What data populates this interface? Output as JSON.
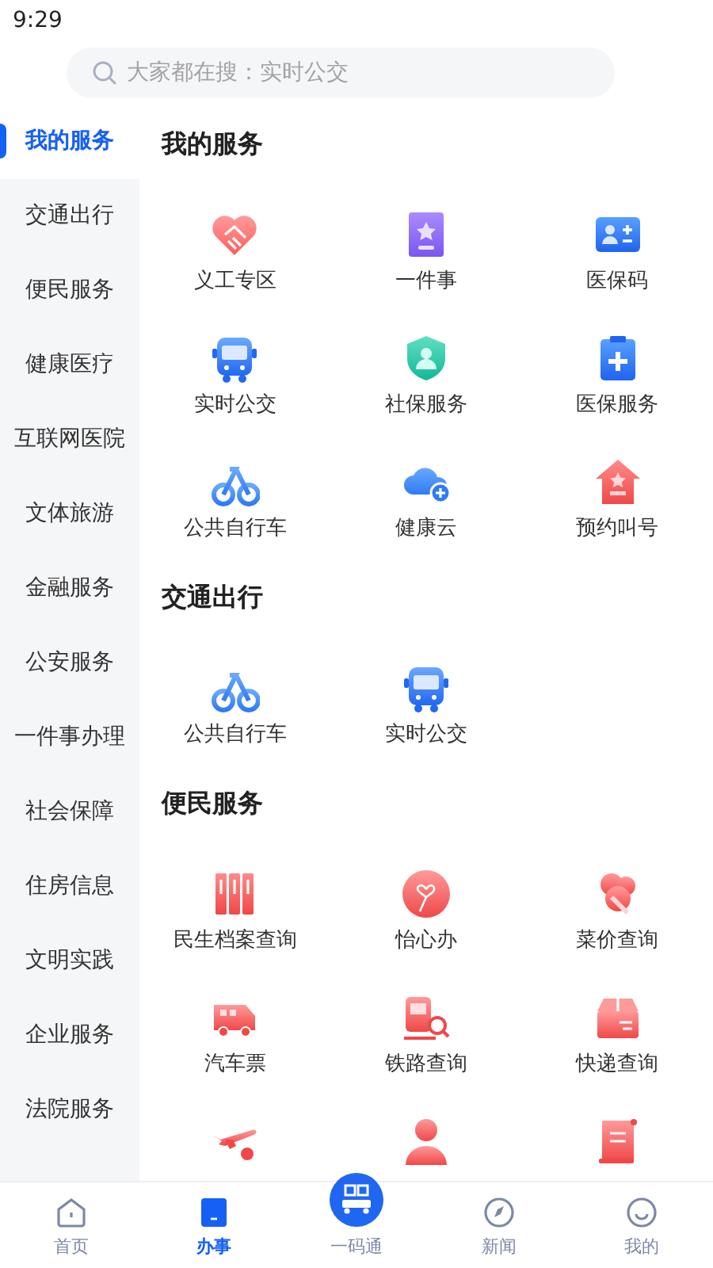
{
  "status_bar": {
    "time": "9:29"
  },
  "search": {
    "placeholder": "大家都在搜：实时公交"
  },
  "sidebar": {
    "items": [
      {
        "label": "我的服务",
        "selected": true
      },
      {
        "label": "交通出行",
        "selected": false
      },
      {
        "label": "便民服务",
        "selected": false
      },
      {
        "label": "健康医疗",
        "selected": false
      },
      {
        "label": "互联网医院",
        "selected": false
      },
      {
        "label": "文体旅游",
        "selected": false
      },
      {
        "label": "金融服务",
        "selected": false
      },
      {
        "label": "公安服务",
        "selected": false
      },
      {
        "label": "一件事办理",
        "selected": false
      },
      {
        "label": "社会保障",
        "selected": false
      },
      {
        "label": "住房信息",
        "selected": false
      },
      {
        "label": "文明实践",
        "selected": false
      },
      {
        "label": "企业服务",
        "selected": false
      },
      {
        "label": "法院服务",
        "selected": false
      }
    ]
  },
  "sections": [
    {
      "title": "我的服务",
      "items": [
        {
          "kind": "labeled",
          "label": "义工专区"
        },
        {
          "kind": "labeled",
          "label": "一件事"
        },
        {
          "kind": "labeled",
          "label": "医保码"
        },
        {
          "kind": "labeled",
          "label": "实时公交"
        },
        {
          "kind": "labeled",
          "label": "社保服务"
        },
        {
          "kind": "labeled",
          "label": "医保服务"
        },
        {
          "kind": "labeled",
          "label": "公共自行车"
        },
        {
          "kind": "labeled",
          "label": "健康云"
        },
        {
          "kind": "labeled",
          "label": "预约叫号"
        }
      ]
    },
    {
      "title": "交通出行",
      "items": [
        {
          "kind": "labeled",
          "label": "公共自行车"
        },
        {
          "kind": "labeled",
          "label": "实时公交"
        }
      ]
    },
    {
      "title": "便民服务",
      "items": [
        {
          "kind": "labeled",
          "label": "民生档案查询"
        },
        {
          "kind": "labeled",
          "label": "怡心办"
        },
        {
          "kind": "labeled",
          "label": "菜价查询"
        },
        {
          "kind": "labeled",
          "label": "汽车票"
        },
        {
          "kind": "labeled",
          "label": "铁路查询"
        },
        {
          "kind": "labeled",
          "label": "快递查询"
        },
        {
          "kind": "icon-only"
        },
        {
          "kind": "icon-only"
        },
        {
          "kind": "icon-only"
        }
      ]
    }
  ],
  "tab_bar": [
    {
      "label": "首页",
      "selected": false
    },
    {
      "label": "办事",
      "selected": true
    },
    {
      "label": "一码通",
      "selected": false
    },
    {
      "label": "新闻",
      "selected": false
    },
    {
      "label": "我的",
      "selected": false
    }
  ]
}
